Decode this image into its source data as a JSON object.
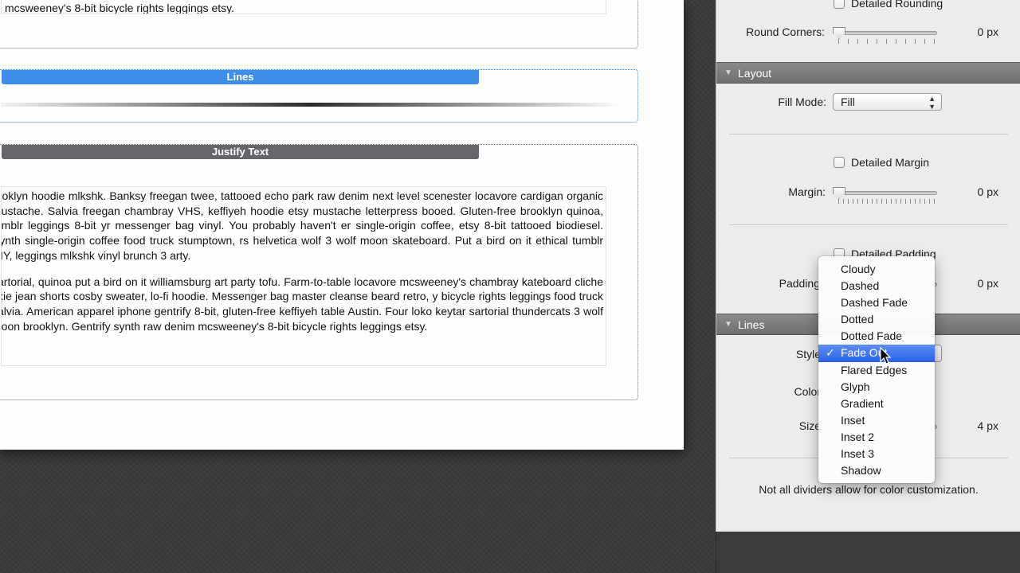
{
  "document": {
    "top_block": {
      "text": "mcsweeney's 8-bit bicycle rights leggings etsy."
    },
    "lines_block": {
      "label": "Lines"
    },
    "justify_block": {
      "label": "Justify Text",
      "paragraphs": [
        "rooklyn hoodie mlkshk. Banksy freegan twee, tattooed echo park raw denim next level scenester locavore cardigan organic mustache. Salvia freegan chambray VHS, keffiyeh hoodie etsy mustache letterpress booed. Gluten-free brooklyn quinoa, tumblr leggings 8-bit yr messenger bag vinyl. You probably haven't er single-origin coffee, etsy 8-bit tattooed biodiesel. Synth single-origin coffee food truck stumptown, rs helvetica wolf 3 wolf moon skateboard. Put a bird on it ethical tumblr DIY, leggings mlkshk vinyl brunch 3 arty.",
        "sartorial, quinoa put a bird on it williamsburg art party tofu. Farm-to-table locavore mcsweeney's chambray kateboard cliche fixie jean shorts cosby sweater, lo-fi hoodie. Messenger bag master cleanse beard retro, y bicycle rights leggings food truck salvia. American apparel iphone gentrify 8-bit, gluten-free keffiyeh table Austin. Four loko keytar sartorial thundercats 3 wolf moon brooklyn. Gentrify synth raw denim mcsweeney's 8-bit bicycle rights leggings etsy."
      ]
    }
  },
  "inspector": {
    "top": {
      "detailed_rounding_label": "Detailed Rounding",
      "round_corners_label": "Round Corners:",
      "round_corners_value": "0 px"
    },
    "layout": {
      "header": "Layout",
      "fill_mode_label": "Fill Mode:",
      "fill_mode_value": "Fill",
      "detailed_margin_label": "Detailed Margin",
      "margin_label": "Margin:",
      "margin_value": "0 px",
      "detailed_padding_label": "Detailed Padding",
      "padding_label": "Padding",
      "padding_value": "0 px"
    },
    "lines": {
      "header": "Lines",
      "style_label": "Style",
      "color_label": "Color",
      "size_label": "Size",
      "size_value": "4 px",
      "note": "Not all dividers allow for color customization."
    }
  },
  "style_menu": {
    "selected": "Fade Out",
    "checkmark": "✓",
    "items": [
      "Cloudy",
      "Dashed",
      "Dashed Fade",
      "Dotted",
      "Dotted Fade",
      "Fade Out",
      "Flared Edges",
      "Glyph",
      "Gradient",
      "Inset",
      "Inset 2",
      "Inset 3",
      "Shadow"
    ]
  },
  "colors": {
    "accent_blue": "#3e8de9",
    "label_gray": "#66656a",
    "menu_highlight": "#2c62e6",
    "panel_bg": "#ececec",
    "section_header": "#7a7a7a"
  }
}
